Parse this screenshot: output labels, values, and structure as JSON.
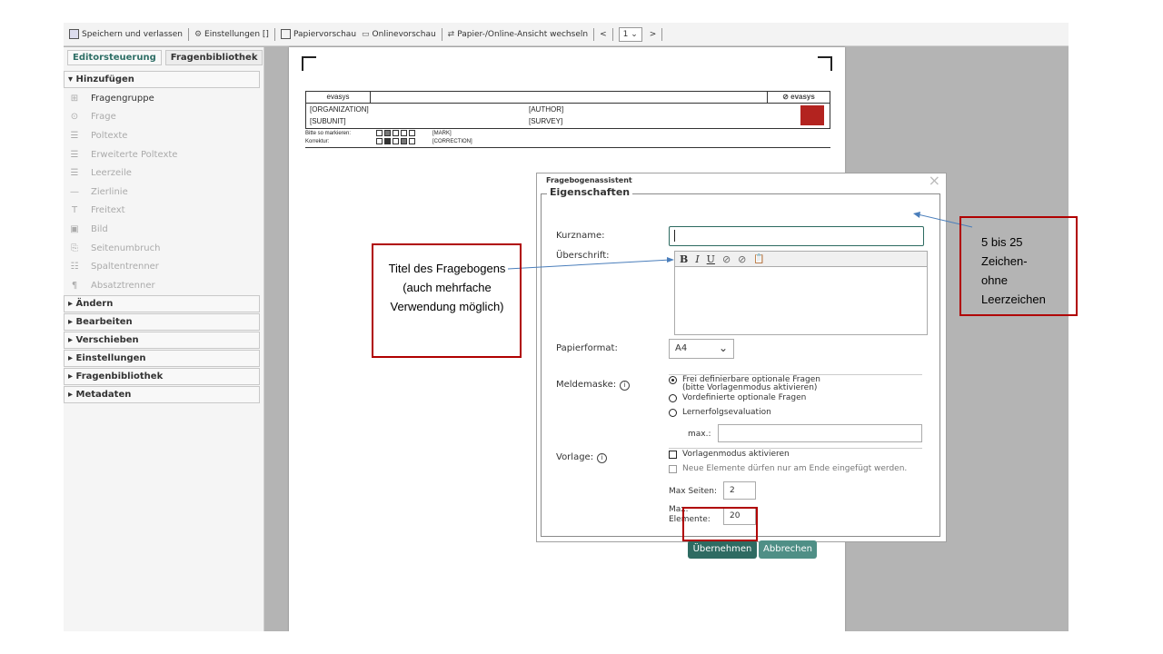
{
  "toolbar": {
    "save_exit": "Speichern und verlassen",
    "settings": "Einstellungen []",
    "paper_preview": "Papiervorschau",
    "online_preview": "Onlinevorschau",
    "switch_view": "Papier-/Online-Ansicht wechseln",
    "prev": "<",
    "page_select": "1",
    "next": ">"
  },
  "left_panel": {
    "tabs": [
      "Editorsteuerung",
      "Fragenbibliothek"
    ],
    "section_add": "▾ Hinzufügen",
    "add_items": [
      {
        "label": "Fragengruppe",
        "icon": "plus-box-icon",
        "glyph": "⊞",
        "enabled": true
      },
      {
        "label": "Frage",
        "icon": "question-icon",
        "glyph": "⊙",
        "enabled": false
      },
      {
        "label": "Poltexte",
        "icon": "poltext-icon",
        "glyph": "☰",
        "enabled": false
      },
      {
        "label": "Erweiterte Poltexte",
        "icon": "extended-poltext-icon",
        "glyph": "☰",
        "enabled": false
      },
      {
        "label": "Leerzeile",
        "icon": "empty-line-icon",
        "glyph": "☰",
        "enabled": false
      },
      {
        "label": "Zierlinie",
        "icon": "decorative-line-icon",
        "glyph": "—",
        "enabled": false
      },
      {
        "label": "Freitext",
        "icon": "freetext-icon",
        "glyph": "T",
        "enabled": false
      },
      {
        "label": "Bild",
        "icon": "image-icon",
        "glyph": "▣",
        "enabled": false
      },
      {
        "label": "Seitenumbruch",
        "icon": "page-break-icon",
        "glyph": "⎘",
        "enabled": false
      },
      {
        "label": "Spaltentrenner",
        "icon": "column-separator-icon",
        "glyph": "☷",
        "enabled": false
      },
      {
        "label": "Absatztrenner",
        "icon": "paragraph-icon",
        "glyph": "¶",
        "enabled": false
      }
    ],
    "sections": [
      "▸ Ändern",
      "▸ Bearbeiten",
      "▸ Verschieben",
      "▸ Einstellungen",
      "▸ Fragenbibliothek",
      "▸ Metadaten"
    ]
  },
  "form_header": {
    "evasys": "evasys",
    "evasys_logo": "⊘ evasys",
    "organization": "[ORGANIZATION]",
    "subunit": "[SUBUNIT]",
    "author": "[AUTHOR]",
    "survey": "[SURVEY]",
    "mark_label": "Bitte so markieren:",
    "mark_tag": "[MARK]",
    "correction_label": "Korrektur:",
    "correction_tag": "[CORRECTION]"
  },
  "dialog": {
    "title": "Fragebogenassistent",
    "legend": "Eigenschaften",
    "kurzname_label": "Kurzname:",
    "kurzname_value": "",
    "ueberschrift_label": "Überschrift:",
    "rte_buttons": [
      "B",
      "I",
      "U",
      "⊘",
      "⊘",
      "📋"
    ],
    "papierformat_label": "Papierformat:",
    "papierformat_value": "A4",
    "meldemaske_label": "Meldemaske:",
    "meldemaske_options": [
      {
        "label": "Frei definierbare optionale Fragen",
        "sub": "(bitte Vorlagenmodus aktivieren)",
        "selected": true
      },
      {
        "label": "Vordefinierte optionale Fragen",
        "sub": "",
        "selected": false
      },
      {
        "label": "Lernerfolgsevaluation",
        "sub": "",
        "selected": false
      }
    ],
    "max_label": "max.:",
    "vorlage_label": "Vorlage:",
    "vorlage_mode": "Vorlagenmodus aktivieren",
    "append_only": "Neue Elemente dürfen nur am Ende eingefügt werden.",
    "max_pages_label": "Max Seiten:",
    "max_pages_value": "2",
    "max_elements_label_1": "Max.",
    "max_elements_label_2": "Elemente:",
    "max_elements_value": "20",
    "apply_button": "Übernehmen",
    "cancel_button": "Abbrechen"
  },
  "annotations": {
    "left_callout": "Titel des Fragebogens (auch mehrfache Verwendung möglich)",
    "right_callout_lines": [
      "5 bis 25",
      "Zeichen-",
      "ohne",
      "Leerzeichen"
    ]
  }
}
